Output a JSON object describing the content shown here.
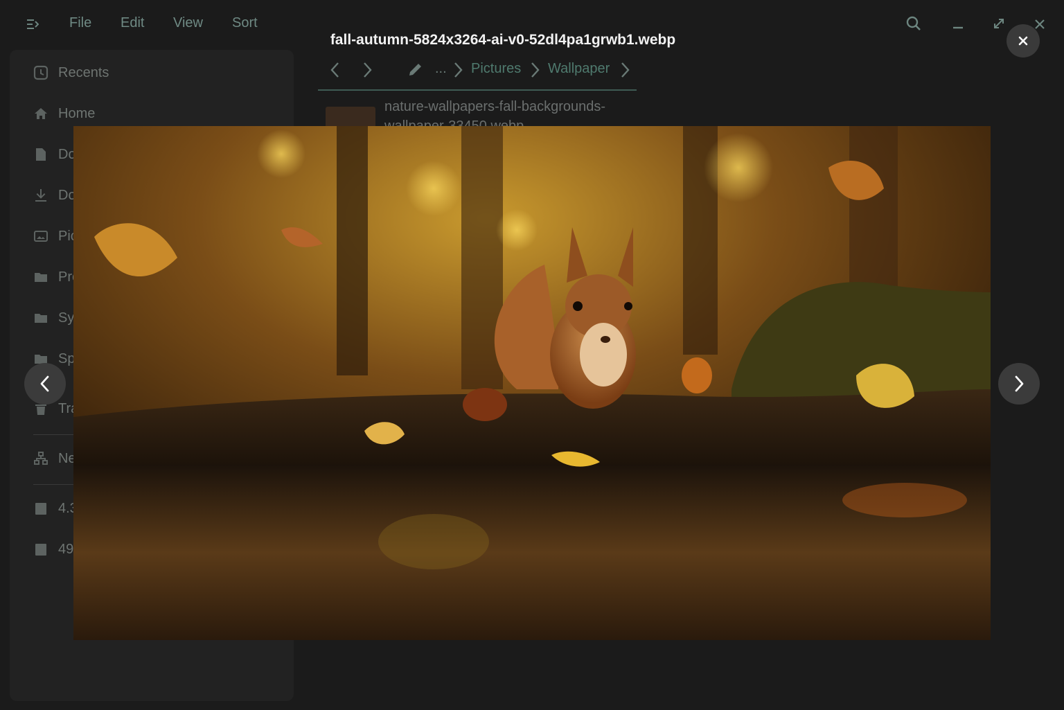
{
  "menubar": {
    "items": [
      {
        "label": "File"
      },
      {
        "label": "Edit"
      },
      {
        "label": "View"
      },
      {
        "label": "Sort"
      }
    ]
  },
  "sidebar": {
    "items": [
      {
        "label": "Recents",
        "icon": "clock-icon"
      },
      {
        "label": "Home",
        "icon": "home-icon"
      },
      {
        "label": "Do",
        "icon": "document-icon"
      },
      {
        "label": "Do",
        "icon": "download-icon"
      },
      {
        "label": "Pic",
        "icon": "picture-icon"
      },
      {
        "label": "Pro",
        "icon": "folder-icon"
      },
      {
        "label": "Sys",
        "icon": "folder-icon"
      },
      {
        "label": "Sp",
        "icon": "folder-icon"
      },
      {
        "label": "Tra",
        "icon": "trash-icon"
      },
      {
        "label": "Ne",
        "icon": "network-icon"
      },
      {
        "label": "4.3",
        "icon": "drive-icon"
      },
      {
        "label": "49",
        "icon": "drive-icon"
      }
    ]
  },
  "breadcrumb": {
    "ellipsis": "...",
    "segments": [
      "Pictures",
      "Wallpaper"
    ]
  },
  "file_list": {
    "visible_row": "nature-wallpapers-fall-backgrounds-wallpaper-33450.webp"
  },
  "viewer": {
    "title": "fall-autumn-5824x3264-ai-v0-52dl4pa1grwb1.webp",
    "close_icon": "close-icon",
    "prev_icon": "chevron-left-icon",
    "next_icon": "chevron-right-icon"
  },
  "colors": {
    "overlay_bg": "#1b1b1b",
    "accent": "#4f7a6e",
    "button_bg": "#3b3b3b"
  }
}
